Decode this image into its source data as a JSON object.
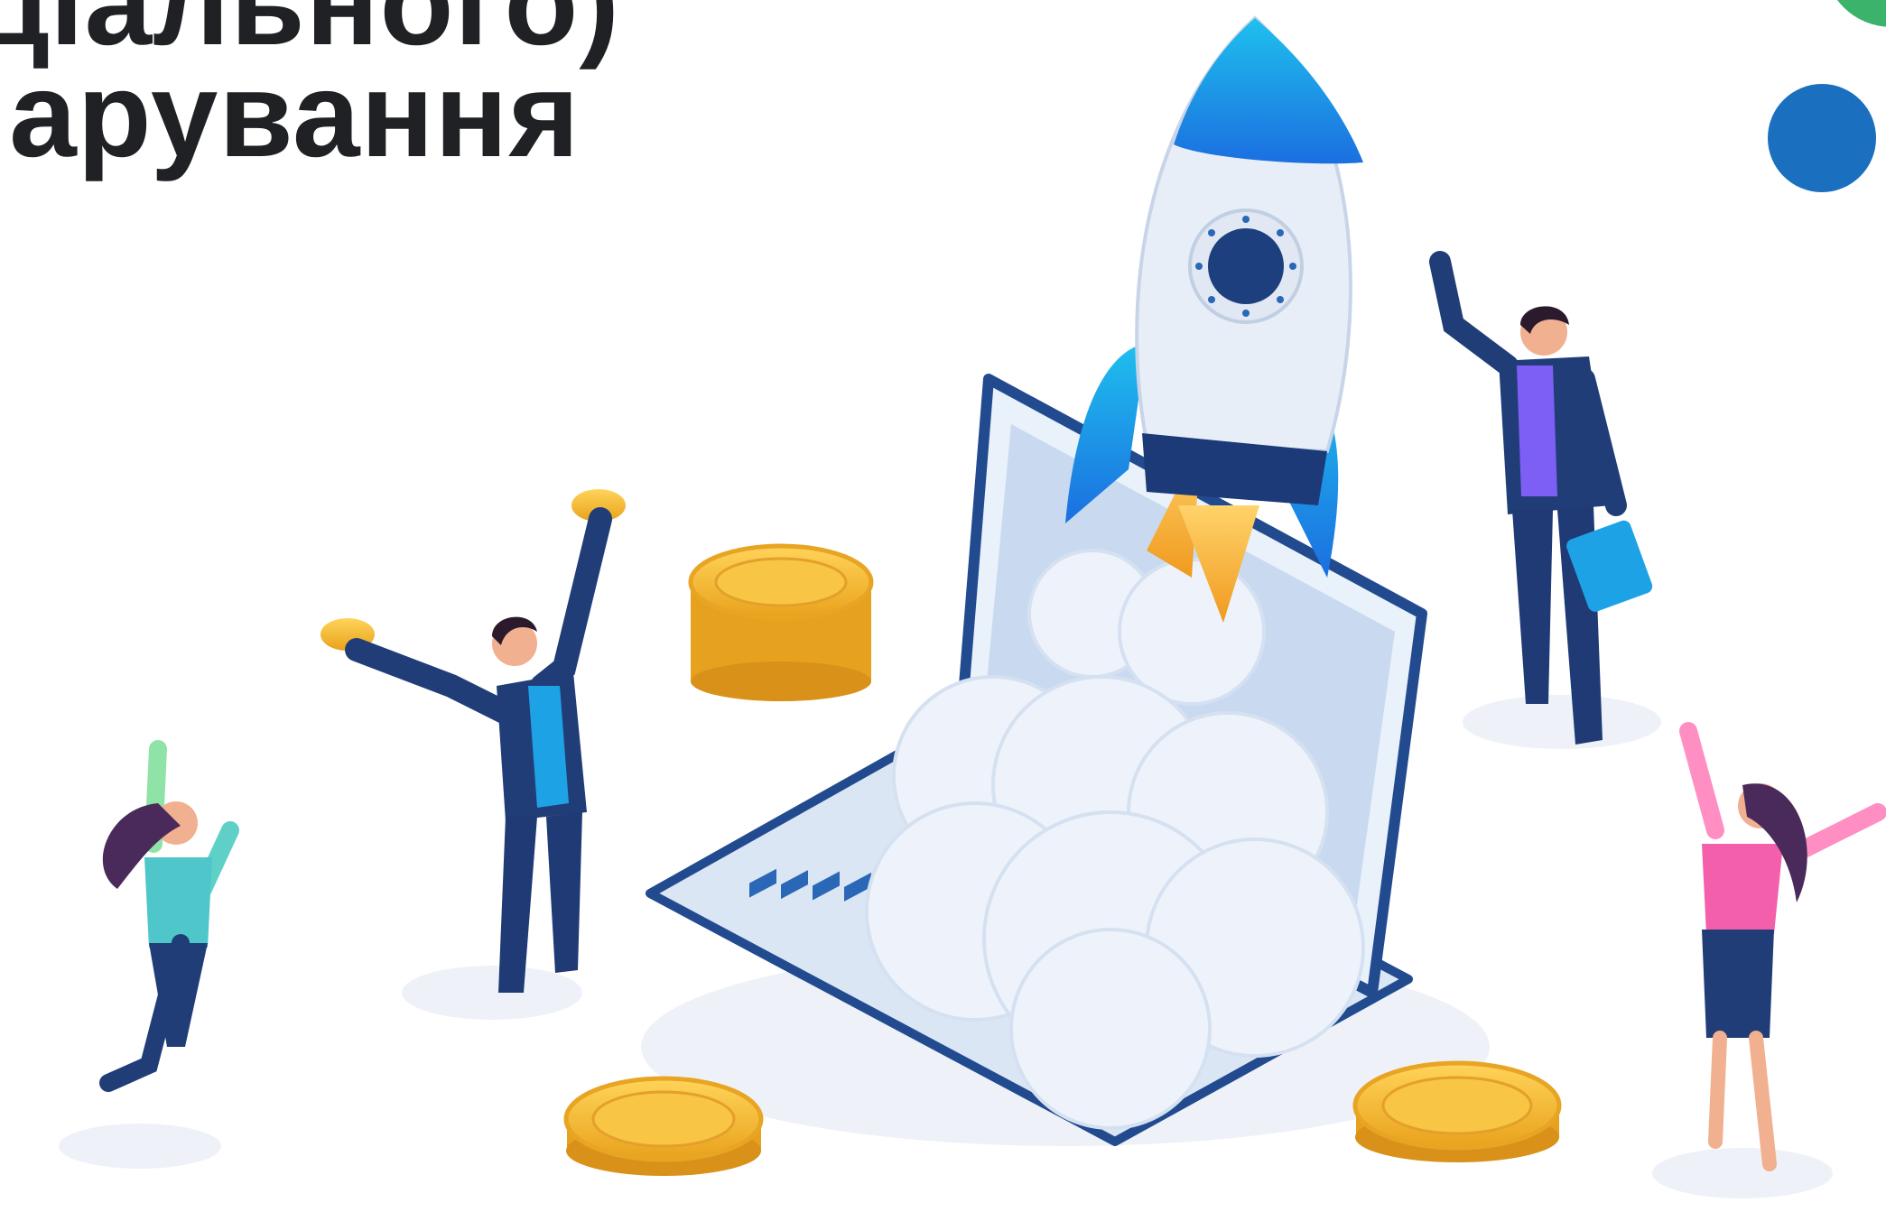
{
  "heading": {
    "line1": "ціального)",
    "line2": "іарування"
  },
  "colors": {
    "heading_text": "#1f2124",
    "accent_blue": "#1a6fbf",
    "accent_green": "#3bb36a",
    "coin_gold": "#f5b72a",
    "suit_navy": "#213d78",
    "rocket_cyan": "#17b6e6"
  },
  "illustration": {
    "scene": "rocket launching from laptop with celebrating business people and gold coins"
  }
}
